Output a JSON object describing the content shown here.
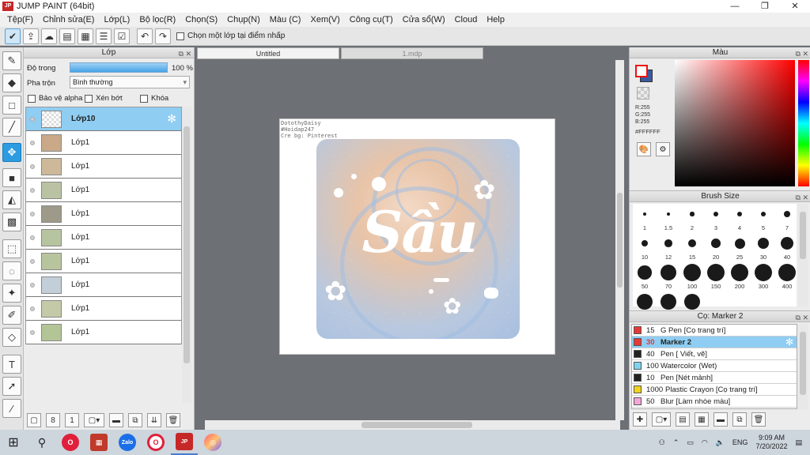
{
  "window": {
    "title": "JUMP PAINT (64bit)",
    "logo_text": "JP",
    "min": "—",
    "restore": "❐",
    "close": "✕"
  },
  "menu": [
    "Tệp(F)",
    "Chỉnh sửa(E)",
    "Lớp(L)",
    "Bộ lọc(R)",
    "Chọn(S)",
    "Chụp(N)",
    "Màu (C)",
    "Xem(V)",
    "Công cụ(T)",
    "Cửa sổ(W)",
    "Cloud",
    "Help"
  ],
  "toolbar": {
    "checkbox_label": "Chọn một lớp tại điểm nhấp"
  },
  "layer_panel": {
    "title": "Lớp",
    "opacity_label": "Độ trong",
    "opacity_value": "100 %",
    "opacity": 1.0,
    "blend_label": "Pha trộn",
    "blend_value": "Bình thường",
    "protect_alpha": "Bảo vệ alpha",
    "clipping": "Xén bớt",
    "lock": "Khóa",
    "layers": [
      {
        "name": "Lớp10",
        "selected": true,
        "thumb": "transparent"
      },
      {
        "name": "Lớp1",
        "thumb": "#c9a988"
      },
      {
        "name": "Lớp1",
        "thumb": "#cdb89a"
      },
      {
        "name": "Lớp1",
        "thumb": "#b9c3a3"
      },
      {
        "name": "Lớp1",
        "thumb": "#9e9a8a"
      },
      {
        "name": "Lớp1",
        "thumb": "#b7c4a0"
      },
      {
        "name": "Lớp1",
        "thumb": "#b8c49e"
      },
      {
        "name": "Lớp1",
        "thumb": "#c2cfd8"
      },
      {
        "name": "Lớp1",
        "thumb": "#c4caa8"
      },
      {
        "name": "Lớp1",
        "thumb": "#b3c596"
      }
    ]
  },
  "doc": {
    "tabs": [
      {
        "label": "Untitled",
        "selected": true
      },
      {
        "label": "1.mdp",
        "selected": false
      }
    ],
    "credits": [
      "DotothyDaisy",
      "#Hoidap247",
      "Cre bg: Pinterest"
    ],
    "art_word": "Sầu"
  },
  "color_panel": {
    "title": "Màu",
    "r": "R:255",
    "g": "G:255",
    "b": "B:255",
    "hex": "#FFFFFF"
  },
  "brush_panel": {
    "title": "Brush Size",
    "sizes": [
      "1",
      "1.5",
      "2",
      "3",
      "4",
      "5",
      "7",
      "10",
      "12",
      "15",
      "20",
      "25",
      "30",
      "40",
      "50",
      "70",
      "100",
      "150",
      "200",
      "300",
      "400",
      "",
      "",
      ""
    ]
  },
  "tool_panel": {
    "title": "Cọ: Marker 2",
    "tools": [
      {
        "size": "15",
        "name": "G Pen [Cọ trang trí]",
        "color": "#e53935"
      },
      {
        "size": "30",
        "name": "Marker 2",
        "color": "#e53935",
        "selected": true
      },
      {
        "size": "40",
        "name": "Pen [ Viết, vẽ]",
        "color": "#222222"
      },
      {
        "size": "100",
        "name": "Watercolor (Wet)",
        "color": "#7fd3f0"
      },
      {
        "size": "10",
        "name": "Pen [Nét mảnh]",
        "color": "#222222"
      },
      {
        "size": "1000",
        "name": "Plastic Crayon [Cọ trang trí]",
        "color": "#f2d31b"
      },
      {
        "size": "50",
        "name": "Blur [Làm nhòe màu]",
        "color": "#f4a6d8"
      }
    ]
  },
  "taskbar": {
    "lang": "ENG",
    "time": "9:09 AM",
    "date": "7/20/2022"
  }
}
